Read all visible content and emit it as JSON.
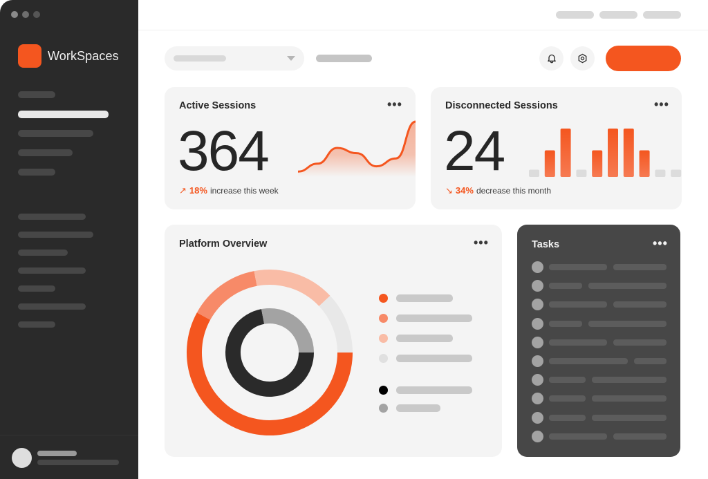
{
  "app": {
    "name": "WorkSpaces",
    "brand_color": "#f4561f",
    "window_controls": [
      {
        "name": "close",
        "color": "#8a8a8a"
      },
      {
        "name": "minimize",
        "color": "#6e6e6e"
      },
      {
        "name": "maximize",
        "color": "#555555"
      }
    ]
  },
  "sidebar": {
    "primary_items": [
      {
        "state": "default"
      },
      {
        "state": "active"
      },
      {
        "state": "default"
      },
      {
        "state": "default"
      },
      {
        "state": "default"
      }
    ],
    "secondary_items": [
      {
        "state": "default"
      },
      {
        "state": "default"
      },
      {
        "state": "default"
      },
      {
        "state": "default"
      },
      {
        "state": "default"
      },
      {
        "state": "default"
      },
      {
        "state": "default"
      }
    ]
  },
  "header": {
    "top_links": 3,
    "dropdown": {
      "caret_icon": "triangle-down"
    },
    "icons": [
      {
        "name": "notifications",
        "icon": "bell-icon"
      },
      {
        "name": "settings",
        "icon": "hexagon-gear-icon"
      }
    ],
    "primary_button": {
      "color": "#f4561f"
    }
  },
  "active_sessions": {
    "title": "Active Sessions",
    "more": "•••",
    "value": "364",
    "delta_arrow": "↗",
    "delta_pct": "18%",
    "delta_text": "increase this week",
    "accent": "#f4561f"
  },
  "disconnected_sessions": {
    "title": "Disconnected Sessions",
    "more": "•••",
    "value": "24",
    "delta_arrow": "↘",
    "delta_pct": "34%",
    "delta_text": "decrease this month",
    "accent": "#f4561f"
  },
  "platform_overview": {
    "title": "Platform Overview",
    "more": "•••"
  },
  "tasks": {
    "title": "Tasks",
    "more": "•••",
    "count": 10
  },
  "chart_data": [
    {
      "type": "line",
      "name": "active-sessions-sparkline",
      "title": "",
      "x": [
        0,
        1,
        2,
        3,
        4,
        5,
        6
      ],
      "values": [
        0.05,
        0.2,
        0.5,
        0.4,
        0.15,
        0.3,
        1.0
      ],
      "ylim": [
        0,
        1
      ],
      "area_fill": true,
      "color": "#f4561f"
    },
    {
      "type": "bar",
      "name": "disconnected-sessions-bars",
      "title": "",
      "categories": [
        "1",
        "2",
        "3",
        "4",
        "5",
        "6",
        "7",
        "8",
        "9",
        "10"
      ],
      "values": [
        0.15,
        0.55,
        1.0,
        0.15,
        0.55,
        1.0,
        1.0,
        0.55,
        0.15,
        0.15
      ],
      "highlighted": [
        false,
        true,
        true,
        false,
        true,
        true,
        true,
        true,
        false,
        false
      ],
      "ylim": [
        0,
        1
      ],
      "colors": {
        "active": "#f4561f",
        "inactive": "#dcdcdc"
      }
    },
    {
      "type": "pie",
      "name": "platform-overview-outer-ring",
      "title": "Platform Overview",
      "values": [
        58,
        14,
        16,
        12
      ],
      "colors": [
        "#f4561f",
        "#f78a68",
        "#f9bca6",
        "#e8e8e8"
      ]
    },
    {
      "type": "pie",
      "name": "platform-overview-inner-ring",
      "values": [
        72,
        28
      ],
      "colors": [
        "#2a2a2a",
        "#a3a3a3"
      ]
    }
  ],
  "legend": [
    {
      "color": "#f4561f"
    },
    {
      "color": "#f78a68"
    },
    {
      "color": "#f9bca6"
    },
    {
      "color": "#e0e0e0"
    },
    {
      "color": "#000000"
    },
    {
      "color": "#a3a3a3"
    }
  ]
}
